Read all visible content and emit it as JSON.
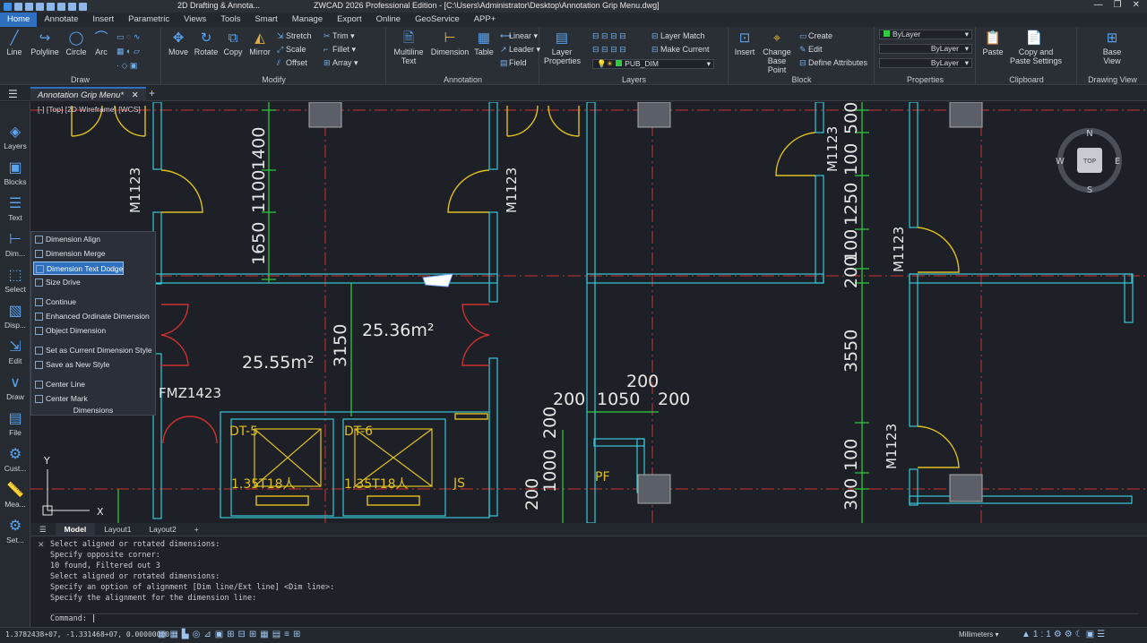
{
  "titlebar": {
    "workspace": "2D Drafting & Annota...",
    "title": "ZWCAD 2026 Professional Edition - [C:\\Users\\Administrator\\Desktop\\Annotation Grip Menu.dwg]"
  },
  "menu": [
    "Home",
    "Annotate",
    "Insert",
    "Parametric",
    "Views",
    "Tools",
    "Smart",
    "Manage",
    "Export",
    "Online",
    "GeoService",
    "APP+"
  ],
  "ribbon": {
    "draw": {
      "label": "Draw",
      "line": "Line",
      "polyline": "Polyline",
      "circle": "Circle",
      "arc": "Arc"
    },
    "modify": {
      "label": "Modify",
      "move": "Move",
      "rotate": "Rotate",
      "copy": "Copy",
      "mirror": "Mirror",
      "stretch": "Stretch",
      "scale": "Scale",
      "offset": "Offset",
      "trim": "Trim",
      "fillet": "Fillet",
      "array": "Array"
    },
    "annotation": {
      "label": "Annotation",
      "mtext": "Multiline Text",
      "dimension": "Dimension",
      "table": "Table",
      "linear": "Linear",
      "leader": "Leader",
      "field": "Field"
    },
    "layers": {
      "label": "Layers",
      "props": "Layer Properties",
      "match": "Layer Match",
      "make_current": "Make Current",
      "current_layer": "PUB_DIM"
    },
    "block": {
      "label": "Block",
      "insert": "Insert",
      "change_base": "Change Base Point",
      "create": "Create",
      "edit": "Edit",
      "define_attr": "Define Attributes"
    },
    "properties": {
      "label": "Properties",
      "color": "ByLayer",
      "linetype": "ByLayer",
      "lineweight": "ByLayer"
    },
    "clipboard": {
      "label": "Clipboard",
      "paste": "Paste",
      "copy_paste": "Copy and Paste Settings"
    },
    "drawing_view": {
      "label": "Drawing View",
      "base_view": "Base View"
    }
  },
  "doc_tab": "Annotation Grip Menu*",
  "view_label": "[-] [Top] [2D Wireframe] [WCS]",
  "leftbar": [
    "Layers",
    "Blocks",
    "Text",
    "Dim...",
    "Select",
    "Disp...",
    "Edit",
    "Draw",
    "File",
    "Cust...",
    "Mea...",
    "Set..."
  ],
  "context_menu": {
    "title": "Dimensions",
    "items": [
      "Dimension Align",
      "Dimension Merge",
      "Dimension Text Dodge",
      "Size Drive",
      "Continue",
      "Enhanced Ordinate Dimension",
      "Object Dimension",
      "Set as Current Dimension Style",
      "Save as New Style",
      "Center Line",
      "Center Mark"
    ],
    "highlighted": "Dimension Text Dodge"
  },
  "drawing": {
    "door_tags": [
      "M1123",
      "M1123",
      "M1123",
      "M1123",
      "M1123"
    ],
    "fire_door": "FMZ1423",
    "elevators": [
      "DT-5",
      "DT-6"
    ],
    "elevator_spec": [
      "1.35T18人",
      "1.35T18人"
    ],
    "js": "JS",
    "pf": "PF",
    "area1": "25.55m²",
    "area2": "25.36m²",
    "dims_v1": [
      "1400",
      "1100",
      "1650"
    ],
    "dim_3150": "3150",
    "dims_h": [
      "200",
      "1050",
      "200"
    ],
    "dim_200_top": "200",
    "dims_v_small": [
      "200",
      "1000",
      "200"
    ],
    "dims_v2": [
      "500",
      "100",
      "1250",
      "100",
      "200",
      "3550",
      "100",
      "300"
    ],
    "compass": {
      "n": "N",
      "s": "S",
      "e": "E",
      "w": "W",
      "top": "TOP"
    }
  },
  "layout_tabs": [
    "Model",
    "Layout1",
    "Layout2"
  ],
  "command_lines": [
    "Select aligned or rotated dimensions:",
    "Specify opposite corner:",
    "10 found, Filtered out 3",
    "Select aligned or rotated dimensions:",
    "Specify an option of alignment [Dim line/Ext line] <Dim line>:",
    "Specify the alignment for the dimension line:"
  ],
  "command_prompt": "Command:",
  "status": {
    "coords": "1.3782438+07, -1.331468+07, 0.00000000",
    "units": "Millimeters"
  }
}
